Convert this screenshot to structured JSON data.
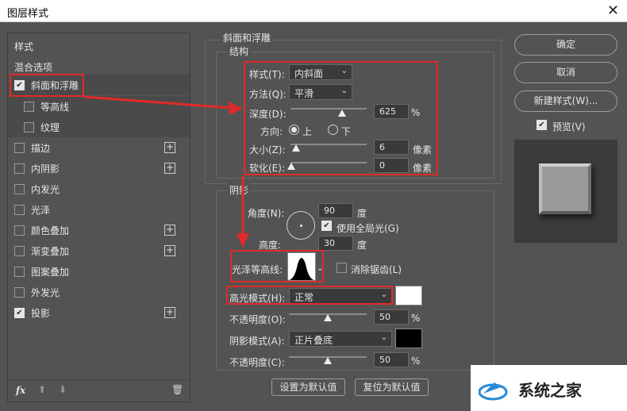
{
  "window": {
    "title": "图层样式",
    "close": "✕"
  },
  "left": {
    "styles_label": "样式",
    "blend_label": "混合选项",
    "items": [
      {
        "label": "斜面和浮雕",
        "checked": true
      },
      {
        "label": "等高线",
        "checked": false
      },
      {
        "label": "纹理",
        "checked": false
      },
      {
        "label": "描边",
        "checked": false,
        "plus": true
      },
      {
        "label": "内阴影",
        "checked": false,
        "plus": true
      },
      {
        "label": "内发光",
        "checked": false
      },
      {
        "label": "光泽",
        "checked": false
      },
      {
        "label": "颜色叠加",
        "checked": false,
        "plus": true
      },
      {
        "label": "渐变叠加",
        "checked": false,
        "plus": true
      },
      {
        "label": "图案叠加",
        "checked": false
      },
      {
        "label": "外发光",
        "checked": false
      },
      {
        "label": "投影",
        "checked": true,
        "plus": true
      }
    ],
    "fx": "fx"
  },
  "bevel": {
    "section_title": "斜面和浮雕",
    "structure_title": "结构",
    "style_label": "样式(T):",
    "style_value": "内斜面",
    "method_label": "方法(Q):",
    "method_value": "平滑",
    "depth_label": "深度(D):",
    "depth_value": "625",
    "depth_unit": "%",
    "direction_label": "方向:",
    "dir_up": "上",
    "dir_down": "下",
    "size_label": "大小(Z):",
    "size_value": "6",
    "size_unit": "像素",
    "soften_label": "软化(E):",
    "soften_value": "0",
    "soften_unit": "像素"
  },
  "shading": {
    "title": "阴影",
    "angle_label": "角度(N):",
    "angle_value": "90",
    "angle_unit": "度",
    "global_light_label": "使用全局光(G)",
    "altitude_label": "高度:",
    "altitude_value": "30",
    "altitude_unit": "度",
    "gloss_label": "光泽等高线:",
    "antialias_label": "消除锯齿(L)",
    "highlight_label": "高光模式(H):",
    "highlight_value": "正常",
    "opacity1_label": "不透明度(O):",
    "opacity1_value": "50",
    "opacity_unit": "%",
    "shadow_label": "阴影模式(A):",
    "shadow_value": "正片叠底",
    "opacity2_label": "不透明度(C):",
    "opacity2_value": "50"
  },
  "footer": {
    "set_default": "设置为默认值",
    "reset_default": "复位为默认值"
  },
  "right": {
    "ok": "确定",
    "cancel": "取消",
    "new_style": "新建样式(W)...",
    "preview": "预览(V)"
  },
  "watermark": {
    "text": "系统之家"
  },
  "colors": {
    "highlight": "#ffffff",
    "shadow": "#000000",
    "annotation": "#e02a2a"
  }
}
